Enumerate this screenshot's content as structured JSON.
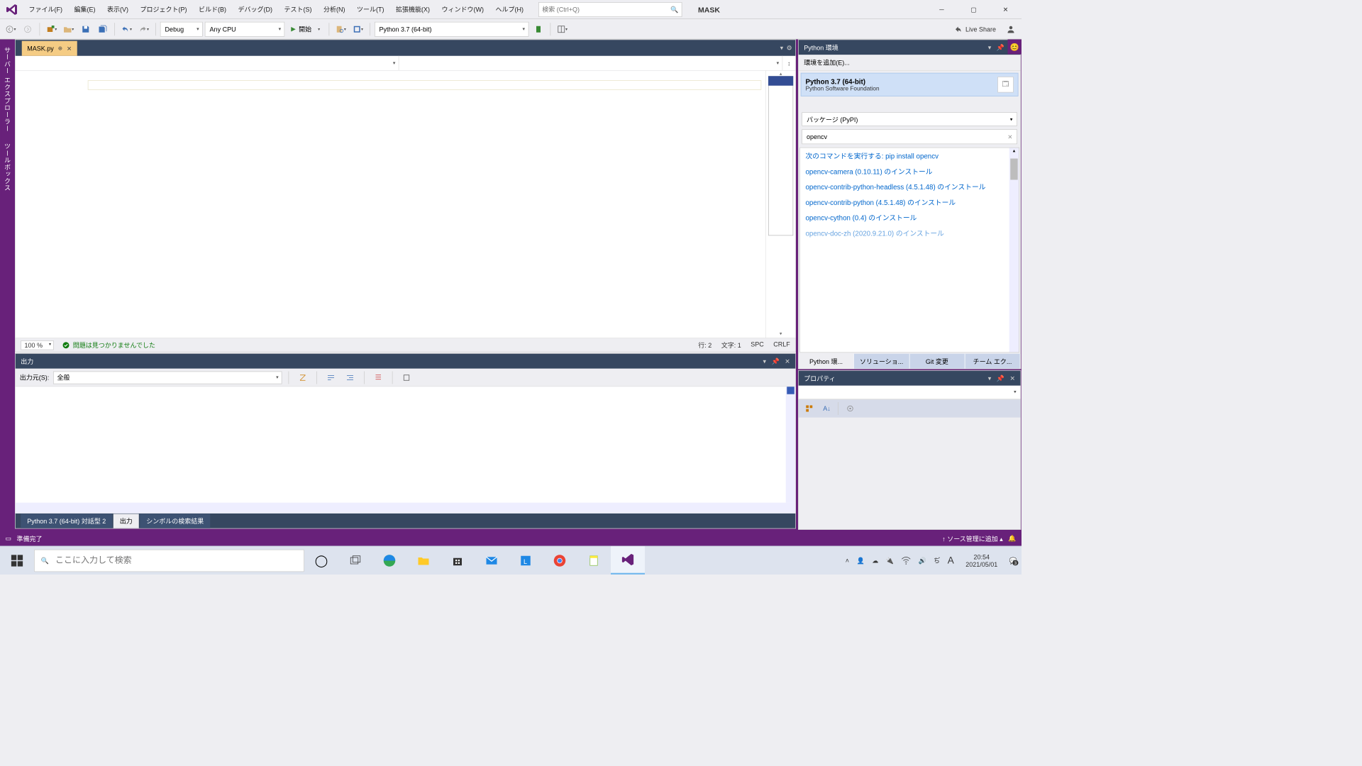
{
  "title": {
    "solution": "MASK"
  },
  "menu": [
    "ファイル(F)",
    "編集(E)",
    "表示(V)",
    "プロジェクト(P)",
    "ビルド(B)",
    "デバッグ(D)",
    "テスト(S)",
    "分析(N)",
    "ツール(T)",
    "拡張機能(X)",
    "ウィンドウ(W)",
    "ヘルプ(H)"
  ],
  "search": {
    "placeholder": "検索 (Ctrl+Q)"
  },
  "toolbar": {
    "config": "Debug",
    "platform": "Any CPU",
    "start": "開始",
    "interpreter": "Python 3.7 (64-bit)",
    "liveshare": "Live Share"
  },
  "sidetabs": [
    "サーバー エクスプローラー",
    "ツールボックス"
  ],
  "editor": {
    "tab": "MASK.py",
    "zoom": "100 %",
    "noissues": "問題は見つかりませんでした",
    "line": "行: 2",
    "col": "文字: 1",
    "ws": "SPC",
    "eol": "CRLF"
  },
  "output": {
    "title": "出力",
    "from_label": "出力元(S):",
    "from_value": "全般",
    "tabs": [
      "Python 3.7 (64-bit) 対話型 2",
      "出力",
      "シンボルの検索結果"
    ],
    "active_tab": 1
  },
  "pyenv": {
    "title": "Python 環境",
    "add": "環境を追加(E)...",
    "env_name": "Python 3.7 (64-bit)",
    "env_sub": "Python Software Foundation",
    "pkg_mode": "パッケージ (PyPI)",
    "search": "opencv",
    "results": [
      "次のコマンドを実行する: pip install opencv",
      "opencv-camera (0.10.11) のインストール",
      "opencv-contrib-python-headless (4.5.1.48) のインストール",
      "opencv-contrib-python (4.5.1.48) のインストール",
      "opencv-cython (0.4) のインストール",
      "opencv-doc-zh (2020.9.21.0) のインストール"
    ],
    "tabs": [
      "Python 環...",
      "ソリューショ...",
      "Git 変更",
      "チーム エク..."
    ]
  },
  "properties": {
    "title": "プロパティ"
  },
  "vsstatus": {
    "ready": "準備完了",
    "scm": "ソース管理に追加"
  },
  "taskbar": {
    "search": "ここに入力して検索",
    "time": "20:54",
    "date": "2021/05/01",
    "notif": "3"
  }
}
